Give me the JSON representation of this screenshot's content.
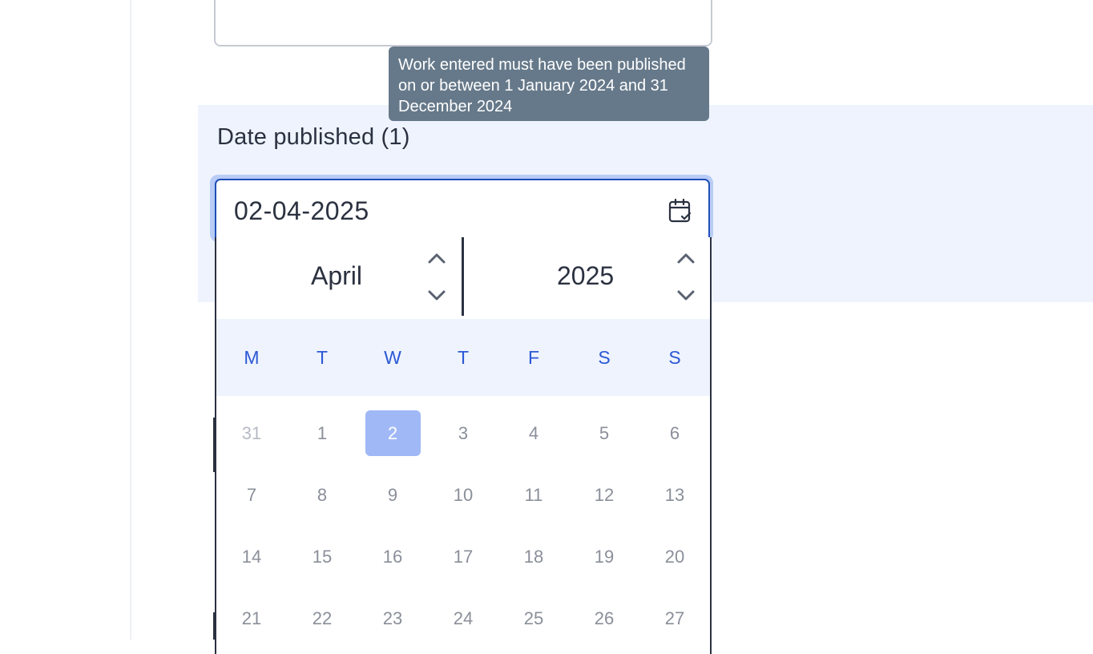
{
  "tooltip": {
    "text": "Work entered must have been published on or between 1 January 2024 and 31 December 2024"
  },
  "field": {
    "label": "Date published (1)",
    "value": "02-04-2025",
    "icon": "calendar-check-icon"
  },
  "picker": {
    "month": "April",
    "year": "2025",
    "weekdays": [
      "M",
      "T",
      "W",
      "T",
      "F",
      "S",
      "S"
    ],
    "weeks": [
      [
        "31",
        "1",
        "2",
        "3",
        "4",
        "5",
        "6"
      ],
      [
        "7",
        "8",
        "9",
        "10",
        "11",
        "12",
        "13"
      ],
      [
        "14",
        "15",
        "16",
        "17",
        "18",
        "19",
        "20"
      ],
      [
        "21",
        "22",
        "23",
        "24",
        "25",
        "26",
        "27"
      ]
    ],
    "selected_day": "2",
    "outside_days": [
      "31"
    ]
  },
  "colors": {
    "accent": "#1f4fb8",
    "weekday_text": "#2b58d6",
    "selected_bg": "#a0b8f6",
    "panel_bg": "#eef3fd",
    "tooltip_bg": "#66798a"
  }
}
